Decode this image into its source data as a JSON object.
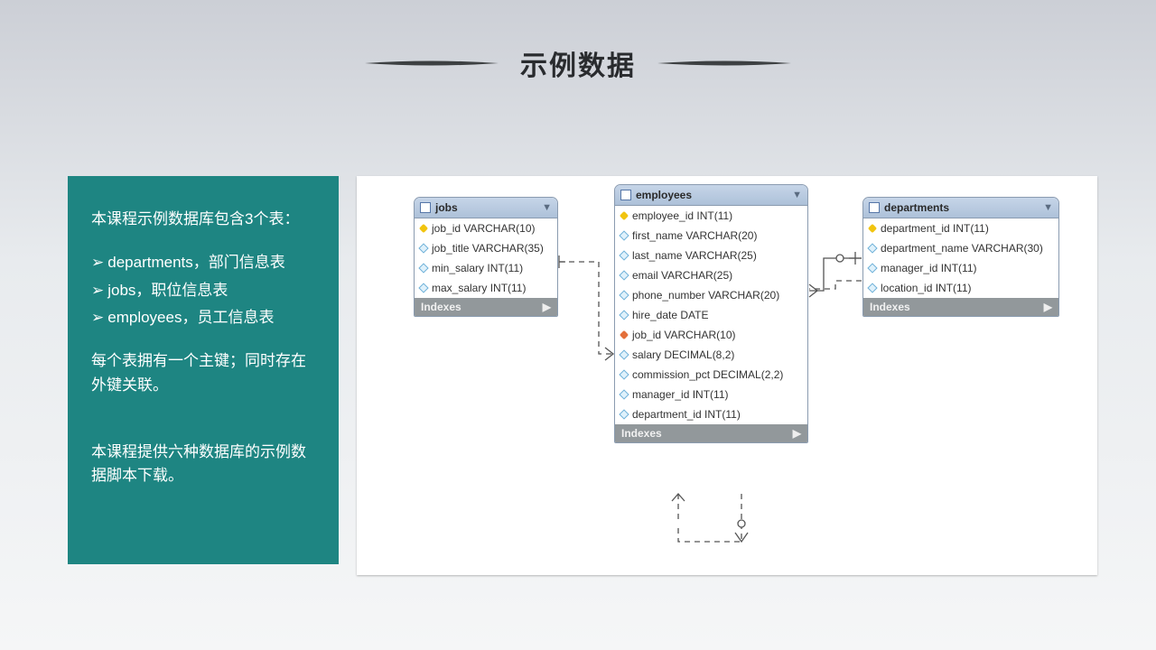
{
  "title": "示例数据",
  "sidebar": {
    "intro": "本课程示例数据库包含3个表：",
    "items": [
      "departments，部门信息表",
      "jobs，职位信息表",
      "employees，员工信息表"
    ],
    "pk_note": "每个表拥有一个主键；同时存在外键关联。",
    "download_note": "本课程提供六种数据库的示例数据脚本下载。"
  },
  "tables": {
    "jobs": {
      "name": "jobs",
      "columns": [
        {
          "icon": "pk",
          "text": "job_id VARCHAR(10)"
        },
        {
          "icon": "col",
          "text": "job_title VARCHAR(35)"
        },
        {
          "icon": "col",
          "text": "min_salary INT(11)"
        },
        {
          "icon": "col",
          "text": "max_salary INT(11)"
        }
      ]
    },
    "employees": {
      "name": "employees",
      "columns": [
        {
          "icon": "pk",
          "text": "employee_id INT(11)"
        },
        {
          "icon": "col",
          "text": "first_name VARCHAR(20)"
        },
        {
          "icon": "col",
          "text": "last_name VARCHAR(25)"
        },
        {
          "icon": "col",
          "text": "email VARCHAR(25)"
        },
        {
          "icon": "col",
          "text": "phone_number VARCHAR(20)"
        },
        {
          "icon": "col",
          "text": "hire_date DATE"
        },
        {
          "icon": "fk",
          "text": "job_id VARCHAR(10)"
        },
        {
          "icon": "col",
          "text": "salary DECIMAL(8,2)"
        },
        {
          "icon": "col",
          "text": "commission_pct DECIMAL(2,2)"
        },
        {
          "icon": "col",
          "text": "manager_id INT(11)"
        },
        {
          "icon": "col",
          "text": "department_id INT(11)"
        }
      ]
    },
    "departments": {
      "name": "departments",
      "columns": [
        {
          "icon": "pk",
          "text": "department_id INT(11)"
        },
        {
          "icon": "col",
          "text": "department_name VARCHAR(30)"
        },
        {
          "icon": "col",
          "text": "manager_id INT(11)"
        },
        {
          "icon": "col",
          "text": "location_id INT(11)"
        }
      ]
    },
    "indexes_label": "Indexes"
  }
}
